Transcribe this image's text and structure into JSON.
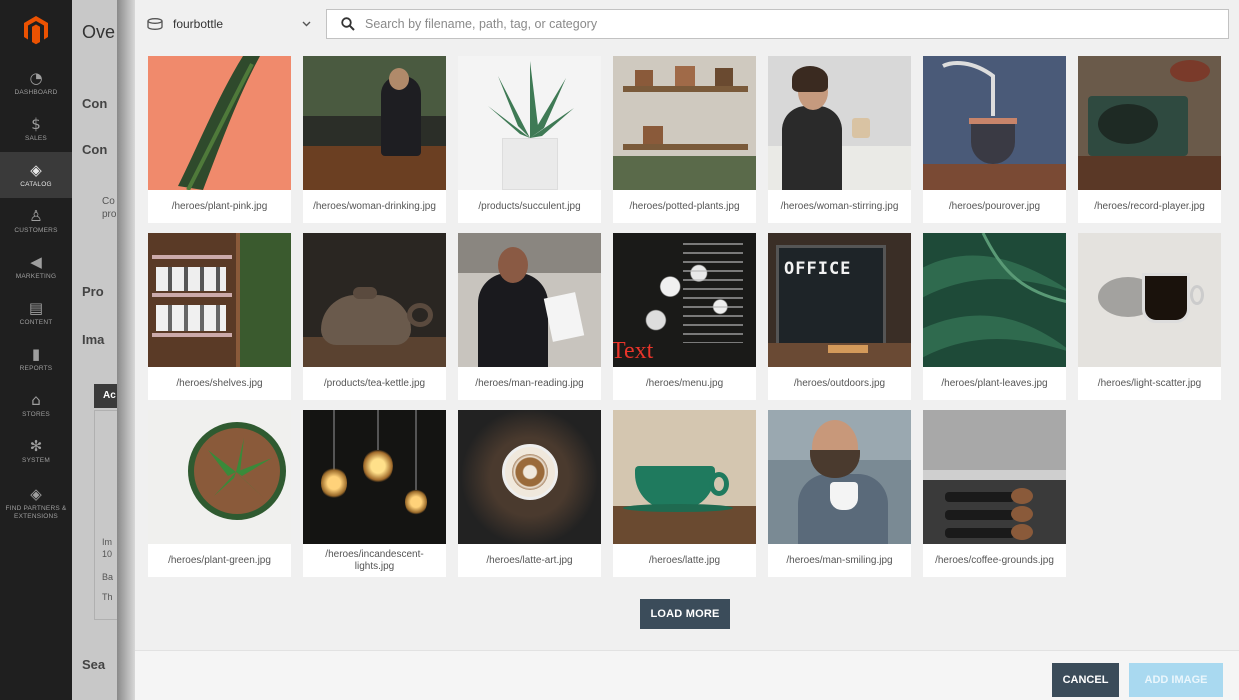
{
  "admin_nav": {
    "items": [
      {
        "label": "DASHBOARD",
        "icon": "dashboard-icon",
        "glyph": "◔"
      },
      {
        "label": "SALES",
        "icon": "dollar-icon",
        "glyph": "$"
      },
      {
        "label": "CATALOG",
        "icon": "cube-icon",
        "glyph": "◈"
      },
      {
        "label": "CUSTOMERS",
        "icon": "person-icon",
        "glyph": "♙"
      },
      {
        "label": "MARKETING",
        "icon": "megaphone-icon",
        "glyph": "◀"
      },
      {
        "label": "CONTENT",
        "icon": "content-icon",
        "glyph": "▤"
      },
      {
        "label": "REPORTS",
        "icon": "bar-chart-icon",
        "glyph": "▮"
      },
      {
        "label": "STORES",
        "icon": "store-icon",
        "glyph": "⌂"
      },
      {
        "label": "SYSTEM",
        "icon": "gear-icon",
        "glyph": "✻"
      },
      {
        "label": "FIND PARTNERS & EXTENSIONS",
        "icon": "extensions-icon",
        "glyph": "◈"
      }
    ]
  },
  "admin_page": {
    "title": "Ove",
    "fragments": [
      "Con",
      "Con",
      "Co",
      "pro",
      "Pro",
      "Ima",
      "Ac",
      "Im",
      "10",
      "Ba",
      "Th",
      "Sea"
    ]
  },
  "modal": {
    "source": "fourbottle",
    "search_placeholder": "Search by filename, path, tag, or category",
    "images": [
      "/heroes/plant-pink.jpg",
      "/heroes/woman-drinking.jpg",
      "/products/succulent.jpg",
      "/heroes/potted-plants.jpg",
      "/heroes/woman-stirring.jpg",
      "/heroes/pourover.jpg",
      "/heroes/record-player.jpg",
      "/heroes/shelves.jpg",
      "/products/tea-kettle.jpg",
      "/heroes/man-reading.jpg",
      "/heroes/menu.jpg",
      "/heroes/outdoors.jpg",
      "/heroes/plant-leaves.jpg",
      "/heroes/light-scatter.jpg",
      "/heroes/plant-green.jpg",
      "/heroes/incandescent-lights.jpg",
      "/heroes/latte-art.jpg",
      "/heroes/latte.jpg",
      "/heroes/man-smiling.jpg",
      "/heroes/coffee-grounds.jpg"
    ],
    "photo_text": {
      "office": "OFFICE",
      "menu_overlay": "Text"
    },
    "load_more": "LOAD MORE",
    "cancel": "CANCEL",
    "add_image": "ADD IMAGE"
  },
  "colors": {
    "nav_bg": "#1f1f1f",
    "brand": "#eb5202",
    "primary_button": "#3b4c5a",
    "disabled_button": "#a9d9f0"
  }
}
